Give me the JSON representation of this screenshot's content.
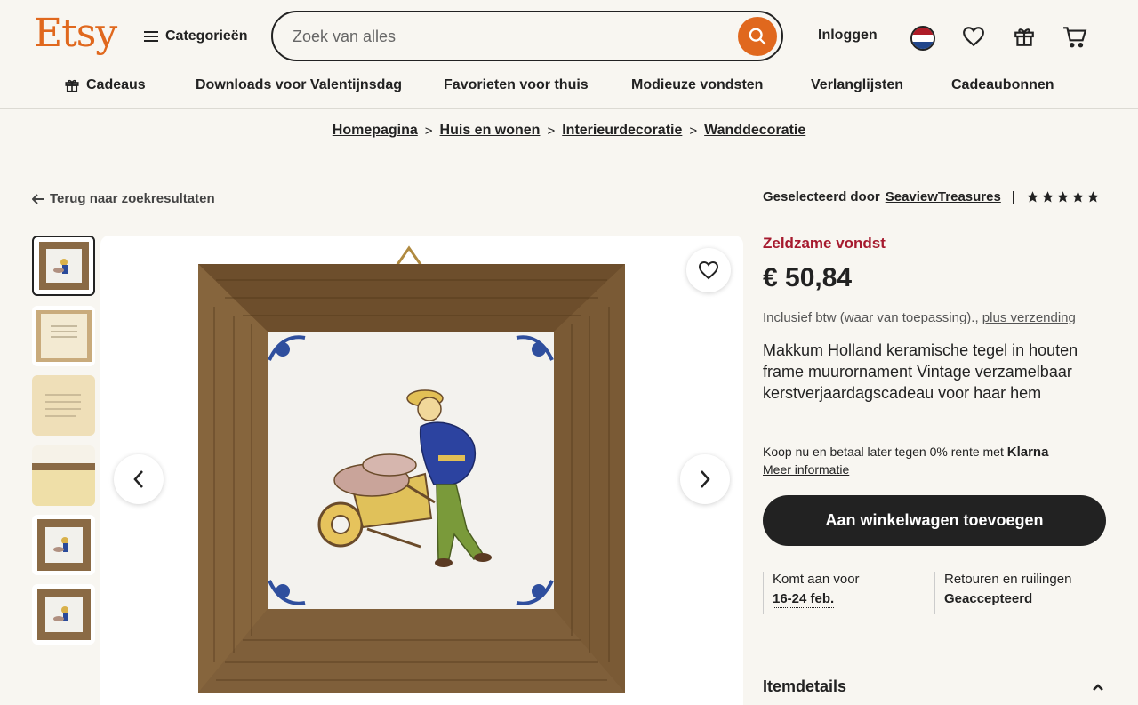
{
  "header": {
    "logo": "Etsy",
    "categories_label": "Categorieën",
    "search_placeholder": "Zoek van alles",
    "login_label": "Inloggen",
    "accent_color": "#e0681e"
  },
  "subnav": {
    "items": [
      {
        "label": "Cadeaus",
        "icon": "gift-icon"
      },
      {
        "label": "Downloads voor Valentijnsdag"
      },
      {
        "label": "Favorieten voor thuis"
      },
      {
        "label": "Modieuze vondsten"
      },
      {
        "label": "Verlanglijsten"
      },
      {
        "label": "Cadeaubonnen"
      }
    ]
  },
  "breadcrumb": [
    "Homepagina",
    "Huis en wonen",
    "Interieurdecoratie",
    "Wanddecoratie"
  ],
  "back_link": "Terug naar zoekresultaten",
  "selected_by": {
    "prefix": "Geselecteerd door",
    "shop": "SeaviewTreasures",
    "rating": 5
  },
  "product": {
    "badge": "Zeldzame vondst",
    "badge_color": "#a61a2e",
    "price": "€ 50,84",
    "vat_text": "Inclusief btw (waar van toepassing).,",
    "shipping_link": "plus verzending",
    "title": "Makkum Holland keramische tegel in houten frame muurornament Vintage verzamelbaar kerstverjaardagscadeau voor haar hem",
    "klarna_text": "Koop nu en betaal later tegen 0% rente met",
    "klarna_brand": "Klarna",
    "klarna_more": "Meer informatie",
    "cart_button": "Aan winkelwagen toevoegen",
    "delivery_label": "Komt aan voor",
    "delivery_value": "16-24 feb.",
    "returns_label": "Retouren en ruilingen",
    "returns_value": "Geaccepteerd",
    "details_heading": "Itemdetails"
  },
  "gallery": {
    "thumbnail_count": 6,
    "active_index": 0
  }
}
